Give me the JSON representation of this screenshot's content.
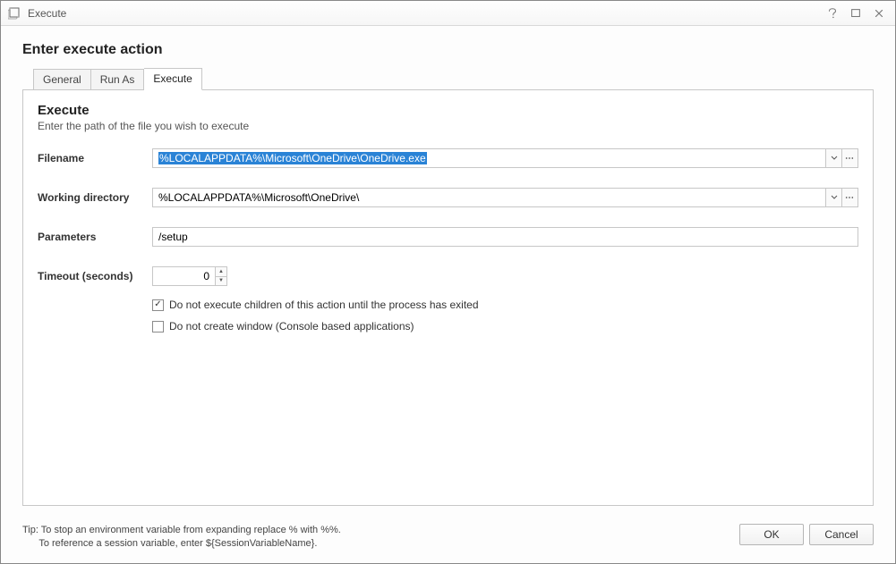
{
  "window": {
    "title": "Execute"
  },
  "page": {
    "heading": "Enter execute action"
  },
  "tabs": {
    "general": "General",
    "runas": "Run As",
    "execute": "Execute"
  },
  "section": {
    "title": "Execute",
    "subtitle": "Enter the path of the file you wish to execute"
  },
  "form": {
    "filename_label": "Filename",
    "filename_value": "%LOCALAPPDATA%\\Microsoft\\OneDrive\\OneDrive.exe",
    "workingdir_label": "Working directory",
    "workingdir_value": "%LOCALAPPDATA%\\Microsoft\\OneDrive\\",
    "parameters_label": "Parameters",
    "parameters_value": "/setup",
    "timeout_label": "Timeout (seconds)",
    "timeout_value": "0",
    "check1_label": "Do not execute children of this action until the process has exited",
    "check1_checked": true,
    "check2_label": "Do not create window (Console based applications)",
    "check2_checked": false
  },
  "footer": {
    "tip_line1": "Tip: To stop an environment variable from expanding replace % with %%.",
    "tip_line2": "To reference a session variable, enter ${SessionVariableName}.",
    "ok_label": "OK",
    "cancel_label": "Cancel"
  },
  "icons": {
    "app": "execute-app-icon",
    "help": "help-icon",
    "maximize": "maximize-icon",
    "close": "close-icon",
    "dropdown": "chevron-down-icon",
    "browse": "ellipsis-icon",
    "spin_up": "spin-up-icon",
    "spin_down": "spin-down-icon"
  }
}
